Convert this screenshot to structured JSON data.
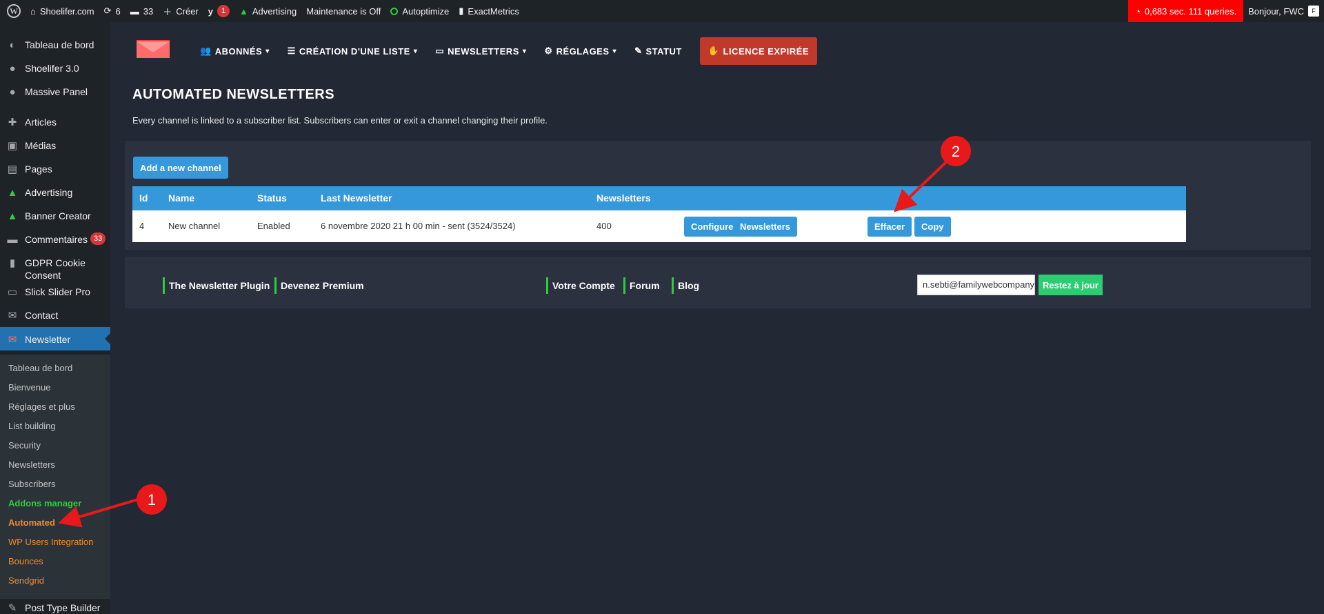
{
  "adminbar": {
    "site_name": "Shoelifer.com",
    "updates_count": "6",
    "comments_count": "33",
    "new_label": "Créer",
    "yoast_badge": "1",
    "advertising": "Advertising",
    "maintenance": "Maintenance is Off",
    "autoptimize": "Autoptimize",
    "exactmetrics": "ExactMetrics",
    "queries": "0,683 sec. 111 queries.",
    "greeting": "Bonjour, FWC",
    "avatar_letter": "F"
  },
  "sidebar": {
    "items": [
      {
        "label": "Tableau de bord",
        "icon": "dashboard-icon"
      },
      {
        "label": "Shoelifer 3.0",
        "icon": "shoelifer-icon"
      },
      {
        "label": "Massive Panel",
        "icon": "bulb-icon"
      },
      {
        "label": "Articles",
        "icon": "pin-icon"
      },
      {
        "label": "Médias",
        "icon": "media-icon"
      },
      {
        "label": "Pages",
        "icon": "pages-icon"
      },
      {
        "label": "Advertising",
        "icon": "advertising-icon"
      },
      {
        "label": "Banner Creator",
        "icon": "banner-icon"
      },
      {
        "label": "Commentaires",
        "icon": "comments-icon",
        "count": "33"
      },
      {
        "label": "GDPR Cookie Consent",
        "icon": "lock-icon"
      },
      {
        "label": "Slick Slider Pro",
        "icon": "slider-icon"
      },
      {
        "label": "Contact",
        "icon": "mail-icon"
      },
      {
        "label": "Newsletter",
        "icon": "newsletter-icon"
      }
    ],
    "submenu": [
      "Tableau de bord",
      "Bienvenue",
      "Réglages et plus",
      "List building",
      "Security",
      "Newsletters",
      "Subscribers",
      "Addons manager",
      "Automated",
      "WP Users Integration",
      "Bounces",
      "Sendgrid"
    ],
    "after": {
      "label": "Post Type Builder",
      "icon": "builder-icon"
    }
  },
  "nav": {
    "subscribers": "ABONNÉS",
    "list_creation": "CRÉATION D'UNE LISTE",
    "newsletters": "NEWSLETTERS",
    "settings": "RÉGLAGES",
    "status": "STATUT",
    "licence": "LICENCE EXPIRÉE"
  },
  "page": {
    "title": "AUTOMATED NEWSLETTERS",
    "description": "Every channel is linked to a subscriber list. Subscribers can enter or exit a channel changing their profile.",
    "add_button": "Add a new channel"
  },
  "table": {
    "headers": [
      "Id",
      "Name",
      "Status",
      "Last Newsletter",
      "Newsletters"
    ],
    "rows": [
      {
        "id": "4",
        "name": "New channel",
        "status": "Enabled",
        "last_newsletter": "6 novembre 2020 21 h 00 min - sent (3524/3524)",
        "newsletters": "400",
        "actions": [
          "Configure",
          "Newsletters",
          "Effacer",
          "Copy"
        ]
      }
    ]
  },
  "footer": {
    "links": [
      "The Newsletter Plugin",
      "Devenez Premium",
      "Votre Compte",
      "Forum",
      "Blog"
    ],
    "email_value": "n.sebti@familywebcompany.com",
    "subscribe_button": "Restez à jour"
  },
  "annotations": {
    "marker_1": "1",
    "marker_2": "2",
    "color": "#e8191b"
  },
  "colors": {
    "accent_blue": "#3498db",
    "admin_bar": "#1d2327",
    "content_bg": "#222834",
    "licence_red": "#c0392b",
    "green": "#2ecc71",
    "current_menu": "#2271b1"
  }
}
